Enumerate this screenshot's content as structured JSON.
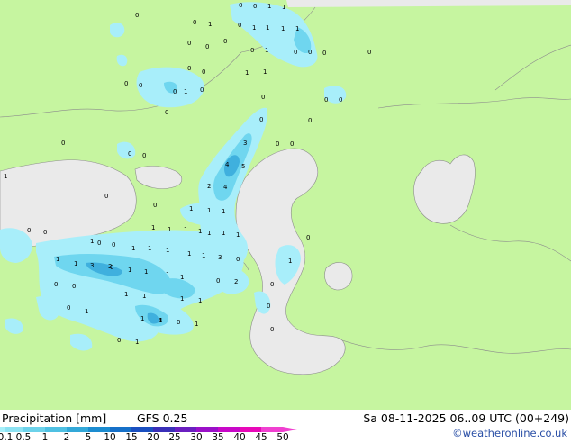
{
  "footer": {
    "title": "Precipitation [mm]",
    "model": "GFS 0.25",
    "valid": "Sa 08-11-2025 06..09 UTC (00+249)",
    "credit": "©weatheronline.co.uk"
  },
  "scale": {
    "ticks": [
      "0.1",
      "0.5",
      "1",
      "2",
      "5",
      "10",
      "15",
      "20",
      "25",
      "30",
      "35",
      "40",
      "45",
      "50"
    ],
    "colors": [
      "#a6f0fa",
      "#8ce2f2",
      "#6cd2ea",
      "#4fc0e2",
      "#33a8d8",
      "#1c8cd0",
      "#1670c8",
      "#1a4fc0",
      "#3a2fb8",
      "#6a1fc0",
      "#9a10c8",
      "#c808c8",
      "#e808b8",
      "#f040d0"
    ]
  },
  "colors": {
    "land": "#c6f5a0",
    "sea": "#eaeaea",
    "precip_light": "#a8eefa",
    "precip_mid": "#6fd6ef",
    "precip_heavy": "#3fb0de",
    "border": "#8c8c8c"
  },
  "map_labels": [
    "0",
    "0",
    "1",
    "1",
    "0",
    "0",
    "1",
    "1",
    "1",
    "0",
    "0",
    "0",
    "0",
    "1",
    "1",
    "0",
    "0",
    "1",
    "0",
    "0",
    "0",
    "0",
    "1",
    "0",
    "1",
    "0",
    "0",
    "0",
    "0",
    "0",
    "1",
    "0",
    "0",
    "0",
    "0",
    "0",
    "3",
    "4",
    "5",
    "2",
    "4",
    "0",
    "0",
    "0",
    "1",
    "1",
    "1",
    "1",
    "1",
    "1",
    "1",
    "1",
    "1",
    "1",
    "1",
    "3",
    "0",
    "1",
    "3",
    "0",
    "1",
    "1",
    "1",
    "1",
    "1",
    "1",
    "1",
    "2",
    "2",
    "0",
    "0",
    "0",
    "0",
    "1",
    "1",
    "0",
    "1",
    "1",
    "1",
    "0",
    "1",
    "1",
    "0",
    "0",
    "0",
    "0",
    "1",
    "0",
    "0",
    "1",
    "0",
    "0",
    "1",
    "4",
    "0",
    "1",
    "1",
    "1",
    "0",
    "1",
    "0",
    "0"
  ]
}
